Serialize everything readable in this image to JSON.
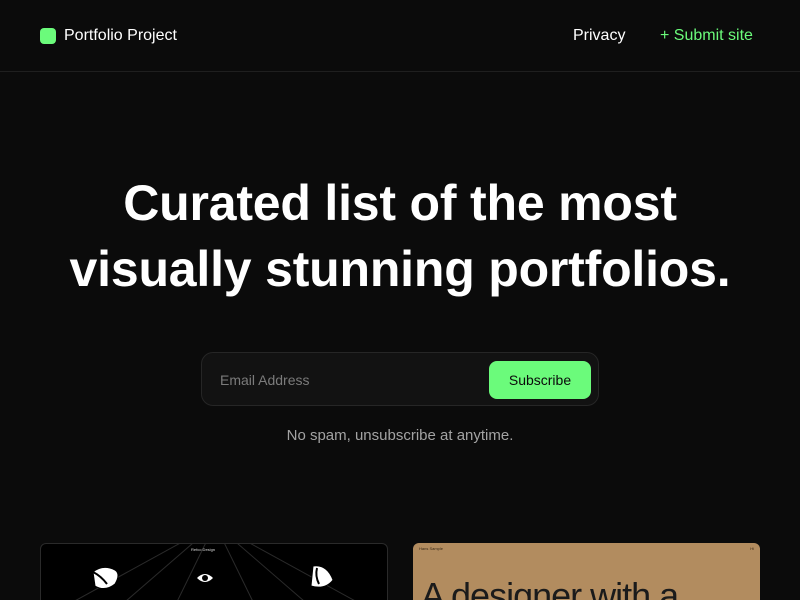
{
  "header": {
    "brand_name": "Portfolio Project",
    "nav": {
      "privacy_label": "Privacy",
      "submit_label": "+ Submit site"
    }
  },
  "hero": {
    "title_line1": "Curated list of the most",
    "title_line2": "visually stunning portfolios."
  },
  "subscribe": {
    "email_placeholder": "Email Address",
    "email_value": "",
    "button_label": "Subscribe",
    "note": "No spam, unsubscribe at anytime."
  },
  "cards": [
    {
      "caption": "Refco Design"
    },
    {
      "caption_left": "Hans Sample",
      "caption_right": "Hi",
      "heading": "A designer with a"
    }
  ],
  "colors": {
    "background": "#0b0b0b",
    "accent": "#6bfb7b",
    "muted_text": "#a3a3a3",
    "card_tan": "#b28c5f"
  },
  "icons": {
    "brand": "green-square-logo-icon"
  }
}
